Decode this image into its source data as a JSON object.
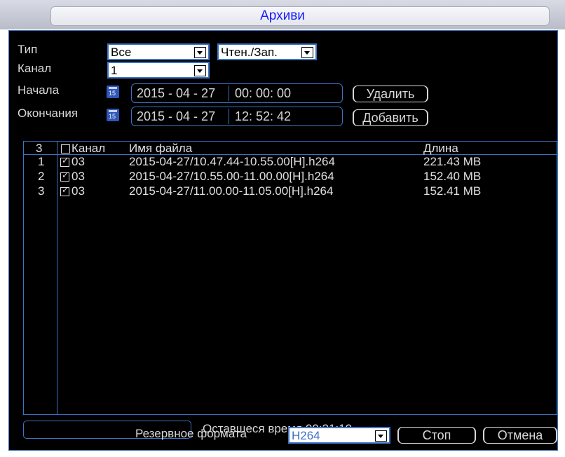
{
  "window": {
    "title": "Архиви"
  },
  "form": {
    "type_label": "Тип",
    "type_value": "Все",
    "mode_value": "Чтен./Зап.",
    "channel_label": "Канал",
    "channel_value": "1",
    "start_label": "Начала",
    "start_date": "2015 - 04 - 27",
    "start_time": "00: 00: 00",
    "end_label": "Окончания",
    "end_date": "2015 - 04 - 27",
    "end_time": "12: 52: 42",
    "delete_button": "Удалить",
    "add_button": "Добавить"
  },
  "table": {
    "headers": {
      "count": "3",
      "channel": "Канал",
      "filename": "Имя файла",
      "length": "Длина"
    },
    "rows": [
      {
        "index": "1",
        "channel": "03",
        "filename": "2015-04-27/10.47.44-10.55.00[H].h264",
        "length": "221.43 MB",
        "checked": true
      },
      {
        "index": "2",
        "channel": "03",
        "filename": "2015-04-27/10.55.00-11.00.00[H].h264",
        "length": "152.40 MB",
        "checked": true
      },
      {
        "index": "3",
        "channel": "03",
        "filename": "2015-04-27/11.00.00-11.05.00[H].h264",
        "length": "152.41 MB",
        "checked": true
      }
    ]
  },
  "status": {
    "remaining_time": "Оставшеся время 00:21:10"
  },
  "footer": {
    "format_label": "Резервное формата",
    "format_value": "H264",
    "stop_button": "Стоп",
    "cancel_button": "Отмена"
  },
  "colors": {
    "accent": "#3d73c3",
    "title_text": "#1a1aff",
    "background": "#000000",
    "text": "#d8d8d8"
  }
}
